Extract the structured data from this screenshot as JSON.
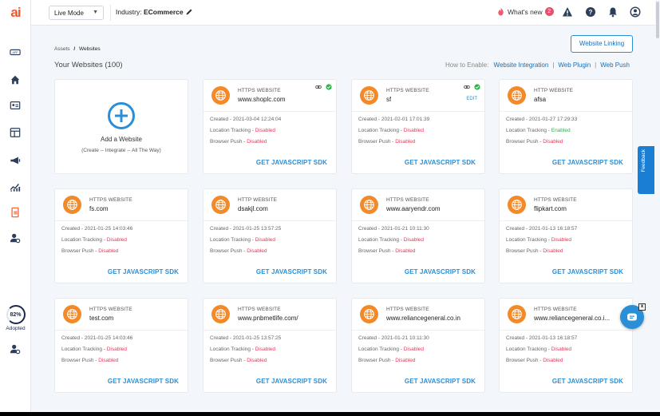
{
  "app": {
    "logo_text": "ai"
  },
  "topbar": {
    "mode": "Live Mode",
    "industry_label": "Industry:",
    "industry_value": "ECommerce",
    "whats_new": "What's new",
    "whats_new_count": "2"
  },
  "sidebar": {
    "adopted_percent": "82%",
    "adopted_label": "Adopted"
  },
  "breadcrumb": {
    "parent": "Assets",
    "separator": "/",
    "current": "Websites"
  },
  "page": {
    "title": "Your Websites (100)",
    "web_linking_button": "Website Linking",
    "how_to_enable": "How to Enable:",
    "links": [
      "Website Integration",
      "Web Plugin",
      "Web Push"
    ]
  },
  "add_card": {
    "title": "Add a Website",
    "subtitle": "(Create -- Integrate -- All The Way)"
  },
  "labels": {
    "created": "Created - ",
    "location": "Location Tracking - ",
    "push": "Browser Push - ",
    "sdk": "GET JAVASCRIPT SDK",
    "edit": "EDIT"
  },
  "websites": [
    {
      "protocol": "HTTPS WEBSITE",
      "site": "www.shoplc.com",
      "created": "2021-03-04 12:24:04",
      "location": "Disabled",
      "push": "Disabled",
      "linked": true,
      "edit": false
    },
    {
      "protocol": "HTTPS WEBSITE",
      "site": "sf",
      "created": "2021-02-01 17:01:39",
      "location": "Disabled",
      "push": "Disabled",
      "linked": true,
      "edit": true
    },
    {
      "protocol": "HTTP WEBSITE",
      "site": "afsa",
      "created": "2021-01-27 17:29:33",
      "location": "Enabled",
      "push": "Disabled",
      "linked": false,
      "edit": false
    },
    {
      "protocol": "HTTPS WEBSITE",
      "site": "fs.com",
      "created": "2021-01-25 14:03:46",
      "location": "Disabled",
      "push": "Disabled",
      "linked": false,
      "edit": false
    },
    {
      "protocol": "HTTP WEBSITE",
      "site": "dsakjl.com",
      "created": "2021-01-25 13:57:25",
      "location": "Disabled",
      "push": "Disabled",
      "linked": false,
      "edit": false
    },
    {
      "protocol": "HTTPS WEBSITE",
      "site": "www.aaryendr.com",
      "created": "2021-01-21 10:11:30",
      "location": "Disabled",
      "push": "Disabled",
      "linked": false,
      "edit": false
    },
    {
      "protocol": "HTTPS WEBSITE",
      "site": "flipkart.com",
      "created": "2021-01-13 16:18:57",
      "location": "Disabled",
      "push": "Disabled",
      "linked": false,
      "edit": false
    },
    {
      "protocol": "HTTPS WEBSITE",
      "site": "test.com",
      "created": "2021-01-25 14:03:46",
      "location": "Disabled",
      "push": "Disabled",
      "linked": false,
      "edit": false
    },
    {
      "protocol": "HTTPS WEBSITE",
      "site": "www.pnbmetlife.com/",
      "created": "2021-01-25 13:57:25",
      "location": "Disabled",
      "push": "Disabled",
      "linked": false,
      "edit": false
    },
    {
      "protocol": "HTTPS WEBSITE",
      "site": "www.reliancegeneral.co.in",
      "created": "2021-01-21 10:11:30",
      "location": "Disabled",
      "push": "Disabled",
      "linked": false,
      "edit": false
    },
    {
      "protocol": "HTTPS WEBSITE",
      "site": "www.reliancegeneral.co.i...",
      "created": "2021-01-13 16:18:57",
      "location": "Disabled",
      "push": "Disabled",
      "linked": false,
      "edit": false
    }
  ],
  "widgets": {
    "feedback": "Feedback",
    "chat_close": "x"
  },
  "colors": {
    "accent": "#2a8fd6",
    "disabled": "#e23a5a",
    "enabled": "#2db34a",
    "globe": "#f28a2a",
    "brand": "#f05a28"
  }
}
